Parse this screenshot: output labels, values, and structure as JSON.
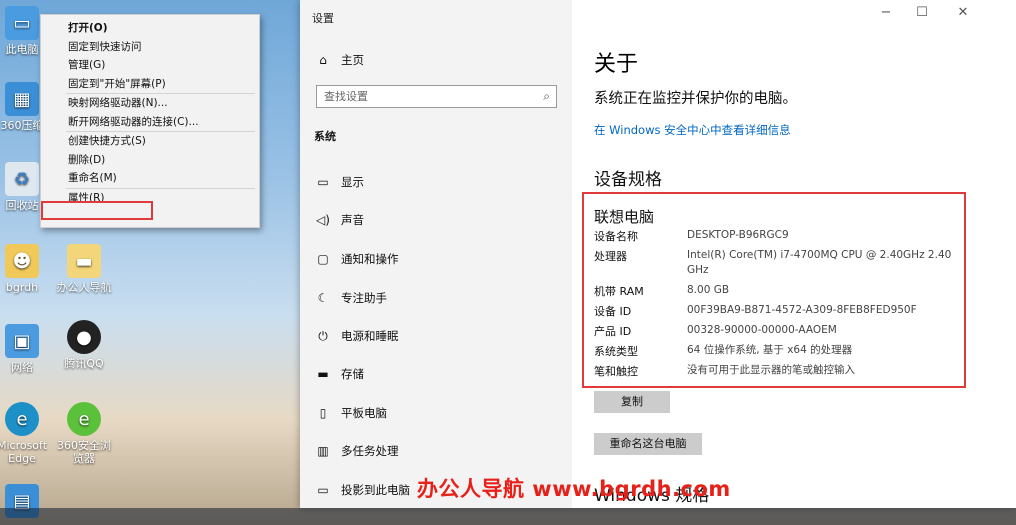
{
  "desktop": {
    "icons": [
      {
        "label": "此电脑",
        "icon": "computer-icon"
      },
      {
        "label": "360压缩",
        "icon": "archive-icon"
      },
      {
        "label": "回收站",
        "icon": "recycle-bin-icon"
      },
      {
        "label": "bgrdh",
        "icon": "user-folder-icon"
      },
      {
        "label": "办公人导航",
        "icon": "folder-icon"
      },
      {
        "label": "网络",
        "icon": "network-icon"
      },
      {
        "label": "腾讯QQ",
        "icon": "qq-icon"
      },
      {
        "label": "Microsoft Edge",
        "icon": "edge-icon"
      },
      {
        "label": "360安全浏览器",
        "icon": "browser-icon"
      }
    ]
  },
  "context_menu": {
    "items": [
      {
        "label": "打开(O)",
        "bold": true
      },
      {
        "label": "固定到快速访问"
      },
      {
        "label": "管理(G)"
      },
      {
        "label": "固定到\"开始\"屏幕(P)"
      },
      {
        "label": "映射网络驱动器(N)..."
      },
      {
        "label": "断开网络驱动器的连接(C)..."
      },
      {
        "label": "创建快捷方式(S)"
      },
      {
        "label": "删除(D)"
      },
      {
        "label": "重命名(M)"
      },
      {
        "label": "属性(R)"
      }
    ]
  },
  "settings": {
    "window_title": "设置",
    "nav_home": "主页",
    "search_placeholder": "查找设置",
    "section": "系统",
    "nav": [
      {
        "label": "显示",
        "icon": "display-icon"
      },
      {
        "label": "声音",
        "icon": "speaker-icon"
      },
      {
        "label": "通知和操作",
        "icon": "notification-icon"
      },
      {
        "label": "专注助手",
        "icon": "moon-icon"
      },
      {
        "label": "电源和睡眠",
        "icon": "power-icon"
      },
      {
        "label": "存储",
        "icon": "storage-icon"
      },
      {
        "label": "平板电脑",
        "icon": "tablet-icon"
      },
      {
        "label": "多任务处理",
        "icon": "multitask-icon"
      },
      {
        "label": "投影到此电脑",
        "icon": "project-icon"
      }
    ],
    "about": {
      "title": "关于",
      "status": "系统正在监控并保护你的电脑。",
      "link": "在 Windows 安全中心中查看详细信息",
      "spec_heading": "设备规格",
      "device_name": "联想电脑",
      "specs": [
        {
          "label": "设备名称",
          "value": "DESKTOP-B96RGC9"
        },
        {
          "label": "处理器",
          "value": "Intel(R) Core(TM) i7-4700MQ CPU @ 2.40GHz   2.40 GHz"
        },
        {
          "label": "机带 RAM",
          "value": "8.00 GB"
        },
        {
          "label": "设备 ID",
          "value": "00F39BA9-B871-4572-A309-8FEB8FED950F"
        },
        {
          "label": "产品 ID",
          "value": "00328-90000-00000-AAOEM"
        },
        {
          "label": "系统类型",
          "value": "64 位操作系统, 基于 x64 的处理器"
        },
        {
          "label": "笔和触控",
          "value": "没有可用于此显示器的笔或触控输入"
        }
      ],
      "copy_button": "复制",
      "rename_button": "重命名这台电脑",
      "win_spec_heading": "Windows 规格"
    }
  },
  "watermark": "办公人导航 www.bgrdh.com"
}
